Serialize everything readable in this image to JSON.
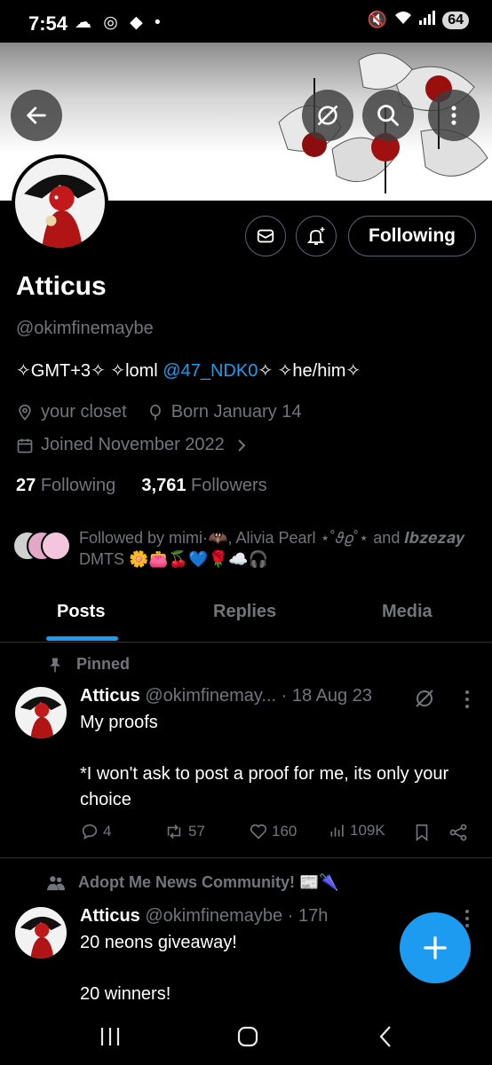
{
  "status_bar": {
    "time": "7:54",
    "left_icons": "☁ ◎ ◆ •",
    "battery": "64"
  },
  "profile": {
    "name": "Atticus",
    "handle": "@okimfinemaybe",
    "bio_prefix": "✧GMT+3✧ ✧loml ",
    "bio_mention": "@47_NDK0",
    "bio_suffix": "✧ ✧he/him✧",
    "location": "your closet",
    "birthday": "Born January 14",
    "joined": "Joined November 2022",
    "following_count": "27",
    "following_label": "Following",
    "followers_count": "3,761",
    "followers_label": "Followers",
    "followed_by": "Followed by mimi·🦇, Alivia Pearl ⋆˚𝜗𝜚˚⋆ and 𝑰𝒃𝒛𝒆𝒛𝒂𝒚 DMTS 🌼👛🍒💙🌹☁️🎧"
  },
  "buttons": {
    "following": "Following"
  },
  "tabs": [
    {
      "label": "Posts",
      "active": true
    },
    {
      "label": "Replies",
      "active": false
    },
    {
      "label": "Media",
      "active": false
    }
  ],
  "tweets": [
    {
      "context": "Pinned",
      "author": "Atticus",
      "handle": "@okimfinemay...",
      "time": "· 18 Aug 23",
      "text": "My proofs\n\n*I won't ask to post a proof for me, its only your choice",
      "replies": "4",
      "retweets": "57",
      "likes": "160",
      "views": "109K"
    },
    {
      "context": "Adopt Me News Community! 📰🌂",
      "author": "Atticus",
      "handle": "@okimfinemaybe",
      "time": "· 17h",
      "text": "20 neons giveaway!\n\n20 winners!"
    }
  ],
  "colors": {
    "accent": "#1d9bf0",
    "muted": "#71767b",
    "background": "#000000",
    "divider": "#2f3336"
  }
}
